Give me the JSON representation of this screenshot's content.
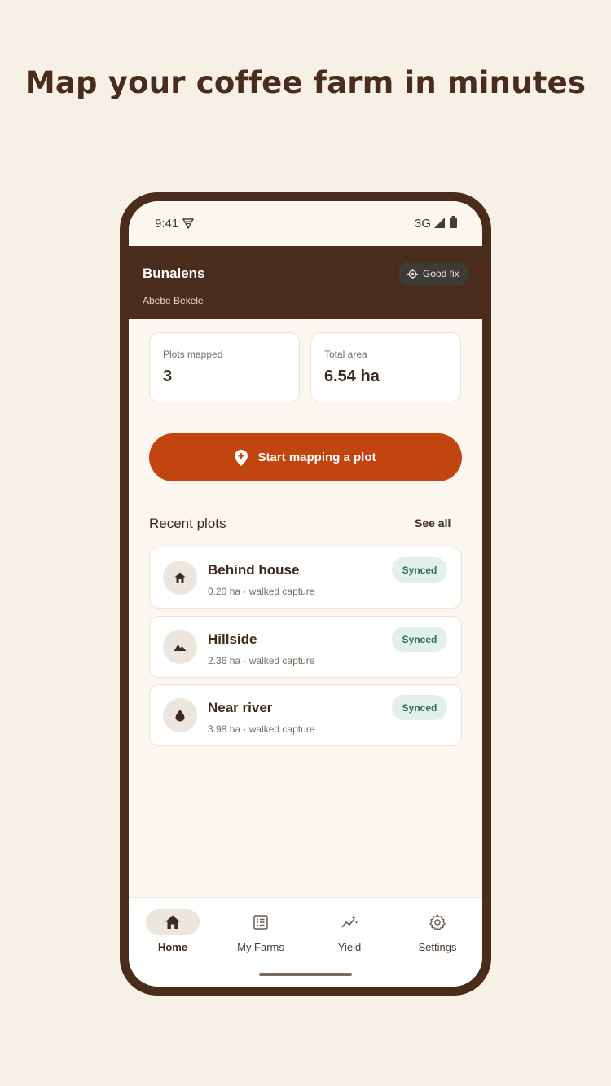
{
  "headline": "Map your coffee farm in minutes",
  "status_bar": {
    "time": "9:41",
    "network": "3G"
  },
  "app_bar": {
    "title": "Bunalens",
    "user": "Abebe Bekele",
    "gps_status": "Good fix"
  },
  "stats": [
    {
      "label": "Plots mapped",
      "value": "3"
    },
    {
      "label": "Total area",
      "value": "6.54 ha"
    }
  ],
  "cta_label": "Start mapping a plot",
  "recent": {
    "title": "Recent plots",
    "see_all": "See all",
    "plots": [
      {
        "name": "Behind house",
        "meta": "0.20 ha · walked capture",
        "status": "Synced",
        "icon": "house-icon"
      },
      {
        "name": "Hillside",
        "meta": "2.36 ha · walked capture",
        "status": "Synced",
        "icon": "mountain-icon"
      },
      {
        "name": "Near river",
        "meta": "3.98 ha · walked capture",
        "status": "Synced",
        "icon": "water-drop-icon"
      }
    ]
  },
  "nav": [
    {
      "label": "Home",
      "icon": "house-icon",
      "active": true
    },
    {
      "label": "My Farms",
      "icon": "list-icon",
      "active": false
    },
    {
      "label": "Yield",
      "icon": "trend-sparkle-icon",
      "active": false
    },
    {
      "label": "Settings",
      "icon": "gear-icon",
      "active": false
    }
  ],
  "colors": {
    "brand_dark": "#4a2c1d",
    "accent": "#c2440f",
    "background": "#f6f0e6",
    "synced_text": "#2d6d5b",
    "synced_bg": "#e3efea"
  }
}
